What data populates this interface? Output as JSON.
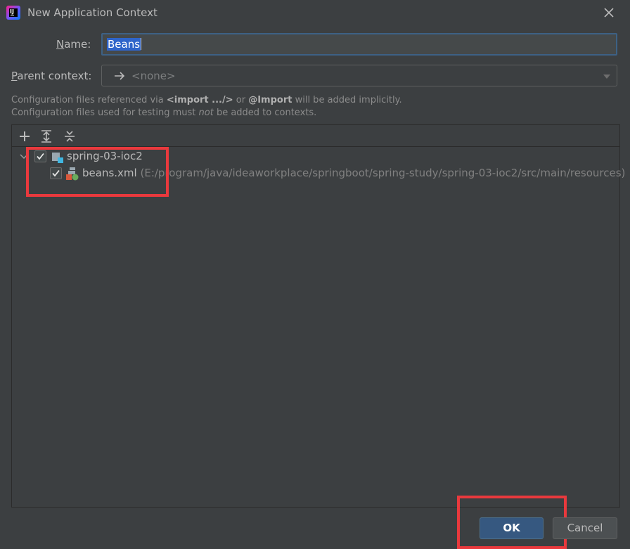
{
  "window": {
    "title": "New Application Context",
    "app_icon": "intellij-idea-icon",
    "close_icon": "close-icon"
  },
  "form": {
    "name_label": "Name:",
    "name_value": "Beans",
    "parent_label": "Parent context:",
    "parent_value": "<none>"
  },
  "hints": {
    "line1_prefix": "Configuration files referenced via ",
    "line1_import_tag": "<import .../>",
    "line1_or": " or ",
    "line1_import_ann": "@Import",
    "line1_suffix": " will be added implicitly.",
    "line2_prefix": "Configuration files used for testing must ",
    "line2_not": "not",
    "line2_suffix": " be added to contexts."
  },
  "toolbar": {
    "add_icon": "add-icon",
    "expand_all_icon": "expand-all-icon",
    "collapse_all_icon": "collapse-all-icon"
  },
  "tree": {
    "module": {
      "label": "spring-03-ioc2",
      "checked": true,
      "expanded": true
    },
    "file": {
      "label": "beans.xml",
      "path": "(E:/program/java/ideaworkplace/springboot/spring-study/spring-03-ioc2/src/main/resources)",
      "checked": true
    }
  },
  "buttons": {
    "ok": "OK",
    "cancel": "Cancel"
  },
  "colors": {
    "background": "#3c3f41",
    "accent": "#365880",
    "highlight_box": "#e9393d",
    "selection": "#2f65ca"
  }
}
